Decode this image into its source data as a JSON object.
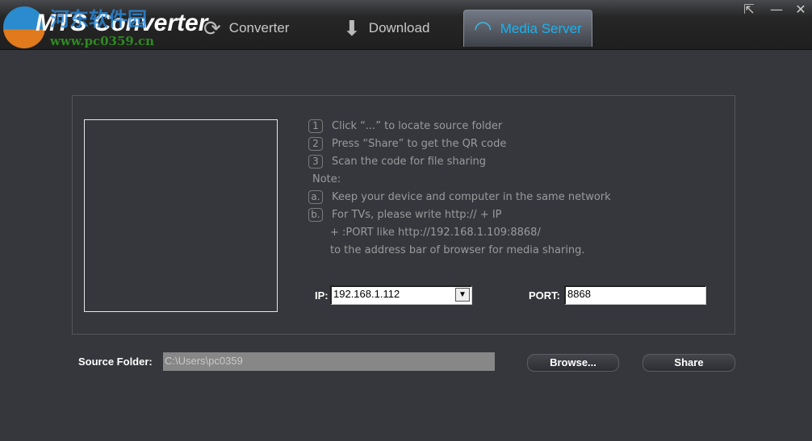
{
  "app": {
    "title": "MTS Converter",
    "watermark_cn": "河东软件园",
    "watermark_url": "www.pc0359.cn"
  },
  "tabs": [
    {
      "label": "Converter",
      "icon": "refresh-icon"
    },
    {
      "label": "Download",
      "icon": "download-icon"
    },
    {
      "label": "Media Server",
      "icon": "wifi-play-icon",
      "active": true
    }
  ],
  "window": {
    "popout": "⇱",
    "minimize": "—",
    "close": "✕"
  },
  "steps": [
    {
      "n": "1",
      "text": "Click “...” to locate source folder"
    },
    {
      "n": "2",
      "text": "Press “Share” to get the QR code"
    },
    {
      "n": "3",
      "text": "Scan the code for file sharing"
    }
  ],
  "note_label": "Note:",
  "notes": [
    {
      "n": "a.",
      "text": "Keep your device and computer in the same network"
    },
    {
      "n": "b.",
      "text": "For TVs, please write http:// + IP"
    }
  ],
  "note_cont": [
    "+ :PORT like http://192.168.1.109:8868/",
    "to the address bar of browser for media sharing."
  ],
  "ip": {
    "label": "IP:",
    "value": "192.168.1.112"
  },
  "port": {
    "label": "PORT:",
    "value": "8868"
  },
  "source": {
    "label": "Source Folder:",
    "value": "C:\\Users\\pc0359"
  },
  "buttons": {
    "browse": "Browse...",
    "share": "Share"
  },
  "colors": {
    "accent": "#1ab2ef",
    "background": "#36373c"
  }
}
